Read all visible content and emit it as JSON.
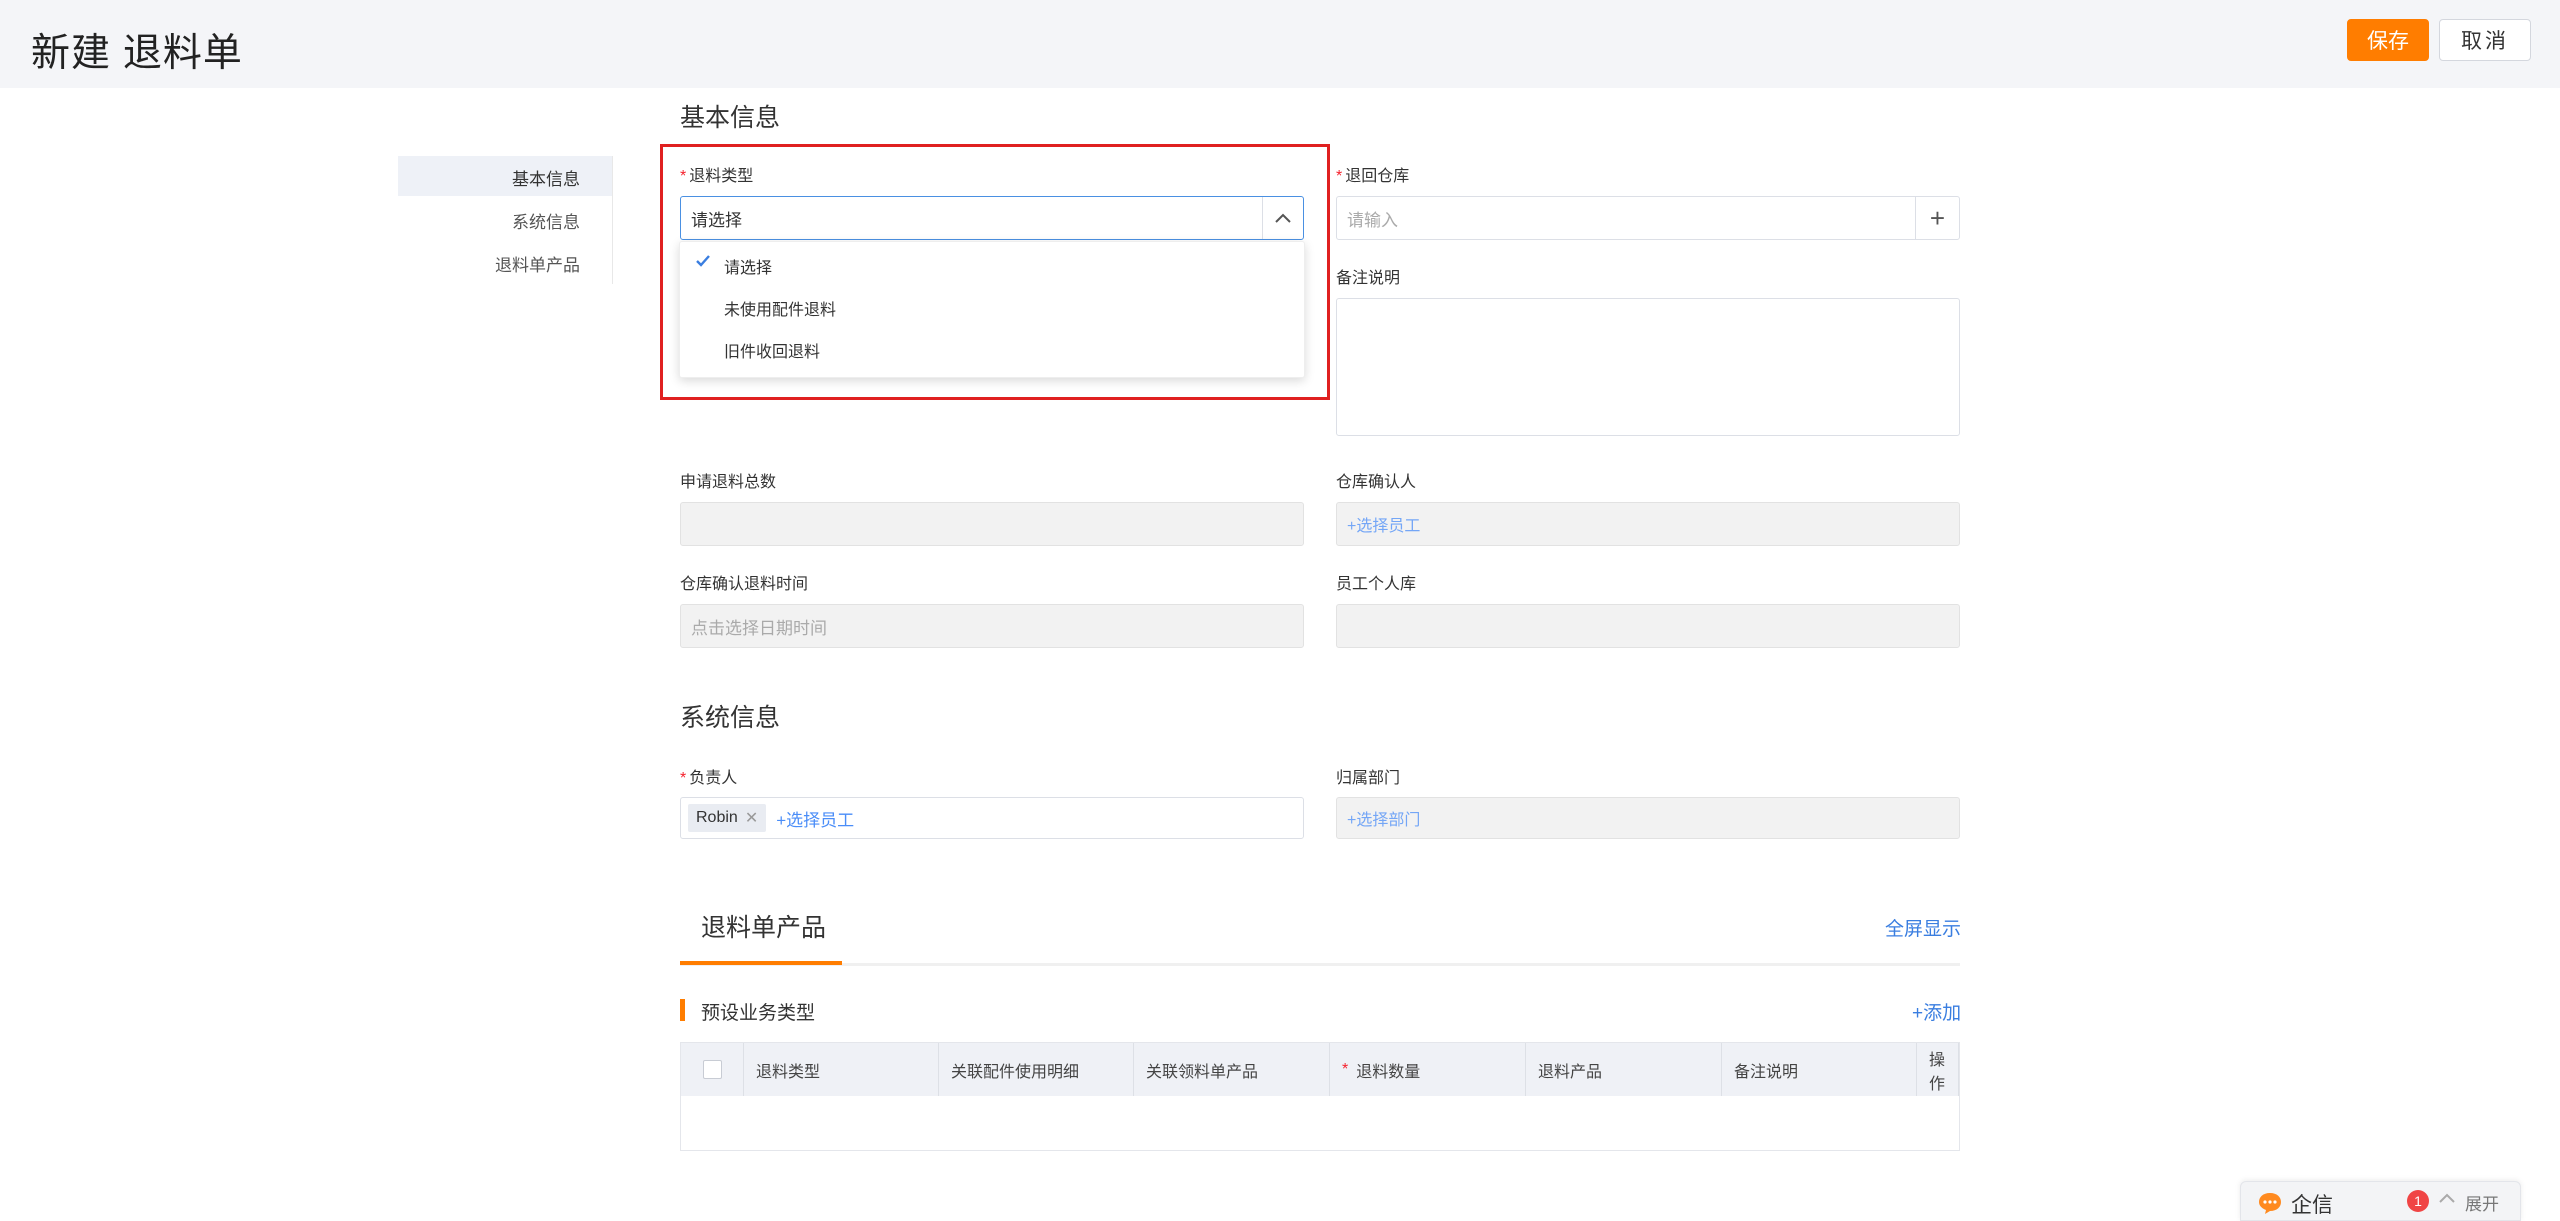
{
  "header": {
    "title": "新建 退料单",
    "save_label": "保存",
    "cancel_label": "取消"
  },
  "section_nav": {
    "items": [
      {
        "label": "基本信息",
        "active": true
      },
      {
        "label": "系统信息",
        "active": false
      },
      {
        "label": "退料单产品",
        "active": false
      }
    ]
  },
  "basic_info": {
    "title": "基本信息",
    "return_type": {
      "label": "退料类型",
      "required": true,
      "value": "请选择",
      "options": [
        "请选择",
        "未使用配件退料",
        "旧件收回退料"
      ],
      "selected_index": 0
    },
    "return_warehouse": {
      "label": "退回仓库",
      "required": true,
      "placeholder": "请输入"
    },
    "remark": {
      "label": "备注说明"
    },
    "total_qty": {
      "label": "申请退料总数"
    },
    "warehouse_confirmer": {
      "label": "仓库确认人",
      "placeholder": "+选择员工"
    },
    "confirm_time": {
      "label": "仓库确认退料时间",
      "placeholder": "点击选择日期时间"
    },
    "personal_store": {
      "label": "员工个人库"
    }
  },
  "system_info": {
    "title": "系统信息",
    "owner": {
      "label": "负责人",
      "required": true,
      "tag": "Robin",
      "add_label": "+选择员工"
    },
    "department": {
      "label": "归属部门",
      "placeholder": "+选择部门"
    }
  },
  "products": {
    "tab_label": "退料单产品",
    "fullscreen_label": "全屏显示",
    "subsection_title": "预设业务类型",
    "add_label": "+添加",
    "columns": [
      "退料类型",
      "关联配件使用明细",
      "关联领料单产品",
      "退料数量",
      "退料产品",
      "备注说明",
      "操作"
    ],
    "required_columns": [
      "退料数量"
    ]
  },
  "chat": {
    "label": "企信",
    "badge": "1",
    "expand_label": "展开"
  },
  "colors": {
    "accent": "#ff7d00",
    "link": "#3a7ee0",
    "required": "#f5222d",
    "highlight_border": "#e02020"
  }
}
